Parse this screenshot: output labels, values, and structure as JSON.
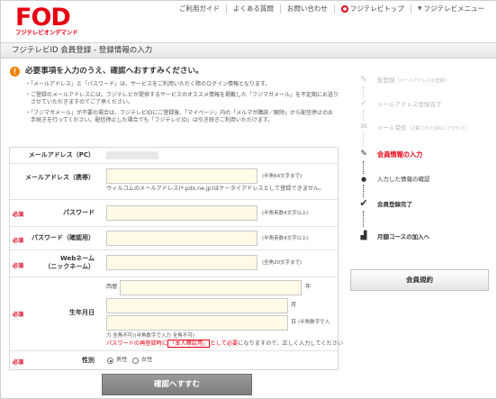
{
  "header": {
    "logo": "FOD",
    "logo_sub": "フジテレビオンデマンド",
    "nav": [
      {
        "label": "ご利用ガイド"
      },
      {
        "label": "よくある質問"
      },
      {
        "label": "お問い合わせ"
      },
      {
        "label": "フジテレビトップ",
        "icon": "fuji-logo-icon"
      },
      {
        "label": "フジテレビメニュー",
        "icon": "chevron-down-icon"
      }
    ]
  },
  "title_bar": {
    "title": "フジテレビID 会員登録 - 登録情報の入力"
  },
  "notice": {
    "title": "必要事項を入力のうえ、確認へおすすみください。",
    "lines": [
      "・「メールアドレス」と「パスワード」は、サービスをご利用いただく際のログイン情報となります。",
      "・ご登録のメールアドレスには、フジテレビが提供するサービスのオススメ情報を掲載した「フジマガメール」を不定期にお送り",
      "　させていただきますのでご了承ください。",
      "・「フジマガメール」が不要の場合は、フジテレビIDにご登録後、「マイページ」内の「メルマガ購読／解除」から配信停止のお",
      "　手続きを行ってください。配信停止した場合でも「フジテレビID」は引き続きご利用いただけます。"
    ]
  },
  "form": {
    "required_label": "必須",
    "email_pc": {
      "label": "メールアドレス（PC）"
    },
    "email_mobile": {
      "label": "メールアドレス（携帯）",
      "hint": "(半角64文字まで)",
      "note": "ウィルコムのメールアドレス(*.pdx.ne.jp)はケータイアドレスとして登録できません。"
    },
    "password": {
      "label": "パスワード",
      "hint": "(半角英数4文字以上)"
    },
    "password_confirm": {
      "label": "パスワード（確認用）",
      "hint": "(半角英数4文字以上)"
    },
    "nickname": {
      "label_1": "Webネーム",
      "label_2": "（ニックネーム）",
      "hint": "(全角20文字まで)"
    },
    "birthday": {
      "label": "生年月日",
      "era_prefix": "西暦",
      "year_unit": "年",
      "month_unit": "月",
      "day_unit": "日",
      "day_hint": "(半角数字で入",
      "wrap_hint": "力 全角不可)(半角数字で入力 全角不可)",
      "warning_pre": "パスワードの再登録時に",
      "warning_box": "「本人確認用」",
      "warning_post": "として必要",
      "warning_tail": "になりますので、正しく入力してください"
    },
    "gender": {
      "label": "性別",
      "options": [
        {
          "label": "男性",
          "selected": true
        },
        {
          "label": "女性",
          "selected": false
        }
      ]
    }
  },
  "confirm_button": "確認へすすむ",
  "steps": [
    {
      "label": "仮登録",
      "detail": "（メールアドレスの登録）",
      "icon": "pencil-icon",
      "state": "done"
    },
    {
      "label": "メールアドレス登録完了",
      "detail": "",
      "icon": "check-icon",
      "state": "done"
    },
    {
      "label": "メール受信",
      "detail": "（記載されたURLにアクセス）",
      "icon": "mail-icon",
      "state": "done"
    },
    {
      "label": "会員情報の入力",
      "detail": "",
      "icon": "pencil-icon",
      "state": "current"
    },
    {
      "label": "入力した情報の確認",
      "detail": "",
      "icon": "dot-icon",
      "state": "todo"
    },
    {
      "label": "会員登録完了",
      "detail": "",
      "icon": "check-icon",
      "state": "todo"
    },
    {
      "label": "月額コースの加入へ",
      "detail": "",
      "icon": "road-icon",
      "state": "todo"
    }
  ],
  "terms_button": "会員規約",
  "colors": {
    "brand": "#e60012",
    "notice_orange": "#f08300",
    "input_bg": "#fffbe6"
  }
}
